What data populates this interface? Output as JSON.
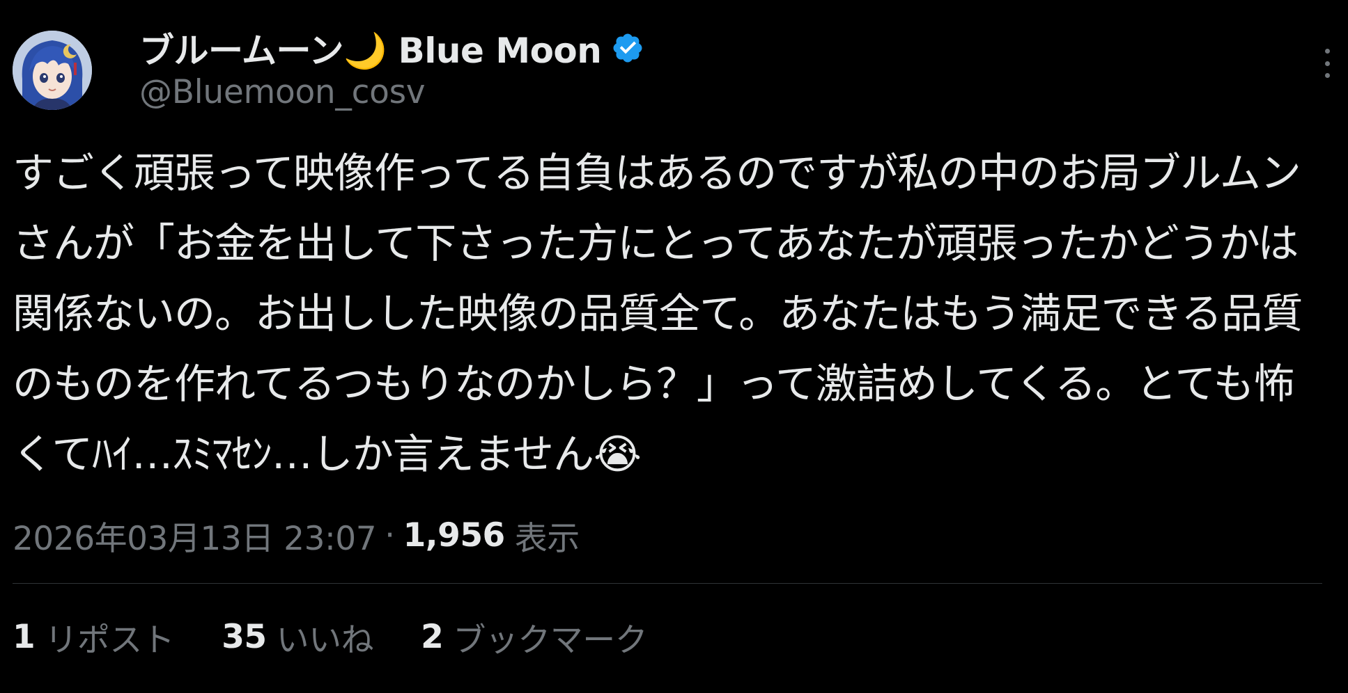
{
  "author": {
    "display_name": "ブルームーン🌙 Blue Moon",
    "handle": "@Bluemoon_cosv",
    "verified": true
  },
  "tweet": {
    "text": "すごく頑張って映像作ってる自負はあるのですが私の中のお局ブルムンさんが「お金を出して下さった方にとってあなたが頑張ったかどうかは関係ないの。お出しした映像の品質全て。あなたはもう満足できる品質のものを作れてるつもりなのかしら？」って激詰めしてくる。とても怖くてﾊｲ…ｽﾐﾏｾﾝ…しか言えません😭"
  },
  "meta": {
    "timestamp": "2026年03月13日 23:07",
    "separator": "·",
    "views_count": "1,956",
    "views_label": "表示"
  },
  "stats": {
    "reposts": {
      "count": "1",
      "label": "リポスト"
    },
    "likes": {
      "count": "35",
      "label": "いいね"
    },
    "bookmarks": {
      "count": "2",
      "label": "ブックマーク"
    }
  },
  "colors": {
    "background": "#000000",
    "text_primary": "#e7e9ea",
    "text_secondary": "#71767b",
    "divider": "#2f3336",
    "verified": "#1d9bf0"
  },
  "icons": {
    "verified": "verified-badge-icon",
    "more": "more-options-icon",
    "avatar": "user-avatar"
  }
}
